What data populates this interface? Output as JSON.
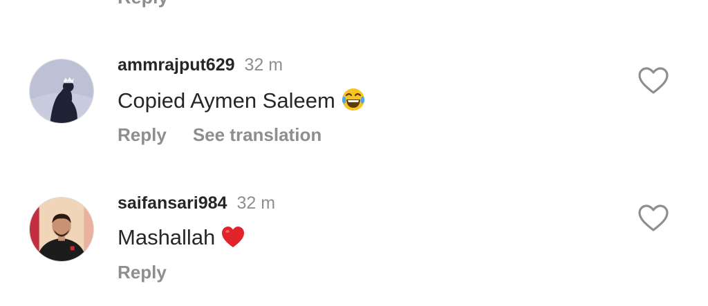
{
  "top": {
    "reply_label": "Reply"
  },
  "comments": [
    {
      "username": "ammrajput629",
      "time": "32 m",
      "text": "Copied Aymen Saleem",
      "emoji": "face-with-tears-of-joy",
      "actions": {
        "reply": "Reply",
        "translate": "See translation"
      },
      "liked": false
    },
    {
      "username": "saifansari984",
      "time": "32 m",
      "text": "Mashallah",
      "emoji": "red-heart",
      "actions": {
        "reply": "Reply"
      },
      "liked": false
    }
  ],
  "colors": {
    "primary_text": "#262626",
    "secondary_text": "#8e8e8e",
    "heart_outline": "#8e8e8e",
    "red_heart": "#e0242a"
  }
}
